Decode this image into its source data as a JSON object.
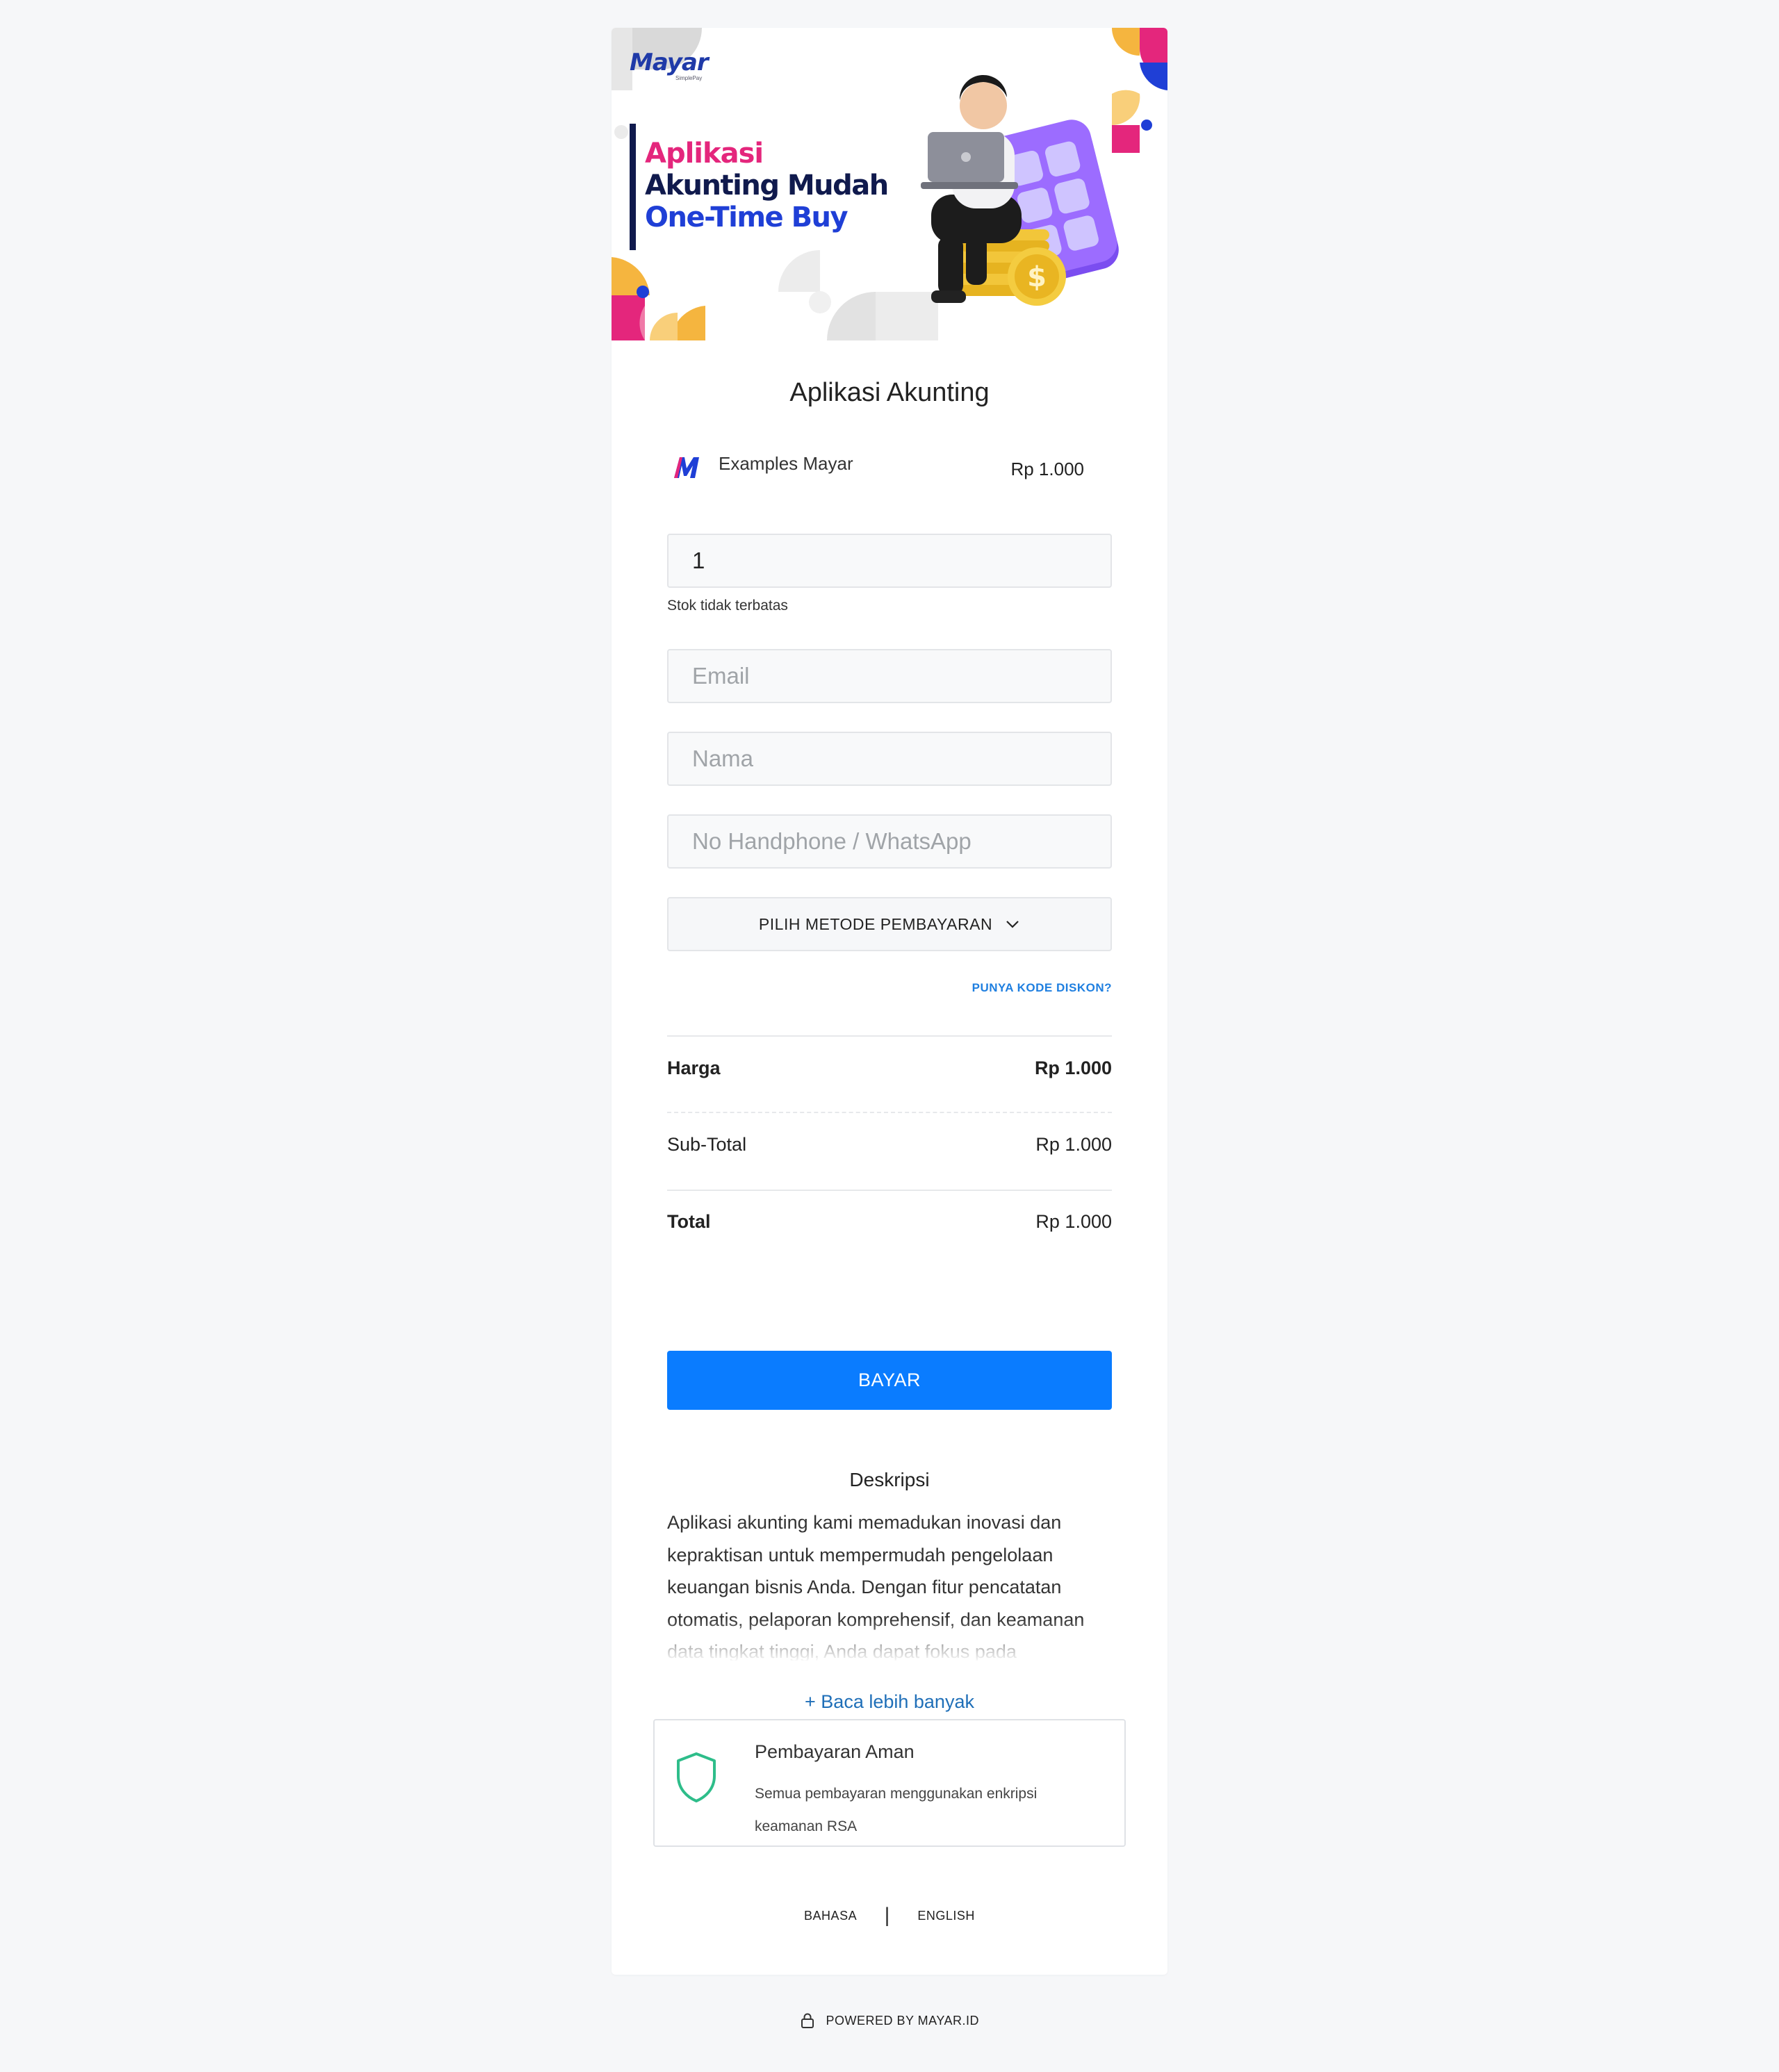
{
  "banner": {
    "logo": "Mayar",
    "logo_sub": "SimplePay",
    "headline_1": "Aplikasi",
    "headline_2": "Akunting Mudah",
    "headline_3": "One-Time Buy"
  },
  "product": {
    "title": "Aplikasi Akunting",
    "store_name": "Examples Mayar",
    "price": "Rp 1.000"
  },
  "form": {
    "quantity_value": "1",
    "stock_note": "Stok tidak terbatas",
    "email_placeholder": "Email",
    "name_placeholder": "Nama",
    "phone_placeholder": "No Handphone / WhatsApp",
    "payment_method_label": "PILIH METODE PEMBAYARAN",
    "discount_link": "PUNYA KODE DISKON?"
  },
  "summary": {
    "harga_label": "Harga",
    "harga_value": "Rp 1.000",
    "subtotal_label": "Sub-Total",
    "subtotal_value": "Rp 1.000",
    "total_label": "Total",
    "total_value": "Rp 1.000"
  },
  "pay_button": "BAYAR",
  "description": {
    "title": "Deskripsi",
    "body": "Aplikasi akunting kami memadukan inovasi dan kepraktisan untuk mempermudah pengelolaan keuangan bisnis Anda. Dengan fitur pencatatan otomatis, pelaporan komprehensif, dan keamanan data tingkat tinggi, Anda dapat fokus pada",
    "read_more": "+ Baca lebih banyak"
  },
  "secure": {
    "title": "Pembayaran Aman",
    "text": "Semua pembayaran menggunakan enkripsi keamanan RSA",
    "icon": "shield-icon"
  },
  "language": {
    "option_1": "BAHASA",
    "separator": "|",
    "option_2": "ENGLISH"
  },
  "footer": {
    "powered_by": "POWERED BY MAYAR.ID",
    "icon": "lock-icon"
  },
  "colors": {
    "accent": "#0a7cff",
    "link": "#1f6fb8",
    "secure_green": "#2ebd8a",
    "brand_pink": "#e4267c",
    "brand_navy": "#101a4d",
    "brand_blue": "#1f3fd6"
  }
}
